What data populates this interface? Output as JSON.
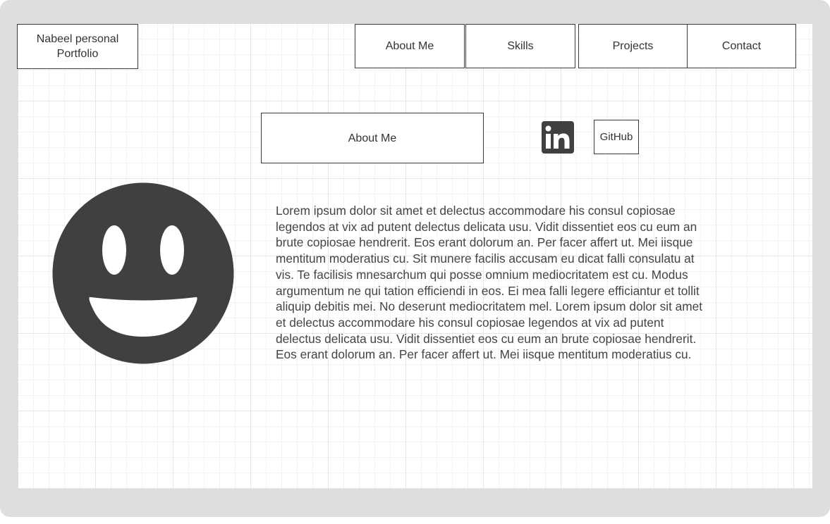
{
  "header": {
    "logo_text": "Nabeel personal Portfolio",
    "nav": {
      "about": "About Me",
      "skills": "Skills",
      "projects": "Projects",
      "contact": "Contact"
    }
  },
  "main": {
    "section_title": "About Me",
    "social": {
      "linkedin_icon": "linkedin-icon",
      "github_label": "GitHub"
    },
    "avatar_icon": "smiley-face-icon",
    "bio": "Lorem ipsum dolor sit amet et delectus accommodare his consul copiosae legendos at vix ad putent delectus delicata usu. Vidit dissentiet eos cu eum an brute copiosae hendrerit. Eos erant dolorum an. Per facer affert ut. Mei iisque mentitum moderatius cu. Sit munere facilis accusam eu dicat falli consulatu at vis. Te facilisis mnesarchum qui posse omnium mediocritatem est cu. Modus argumentum ne qui tation efficiendi in eos. Ei mea falli legere efficiantur et tollit aliquip debitis mei. No deserunt mediocritatem mel. Lorem ipsum dolor sit amet et delectus accommodare his consul copiosae legendos at vix ad putent delectus delicata usu. Vidit dissentiet eos cu eum an brute copiosae hendrerit. Eos erant dolorum an. Per facer affert ut. Mei iisque mentitum moderatius cu."
  },
  "colors": {
    "frame": "#dedede",
    "icon_fill": "#404040",
    "stroke": "#3a3a3a",
    "text": "#444444"
  }
}
